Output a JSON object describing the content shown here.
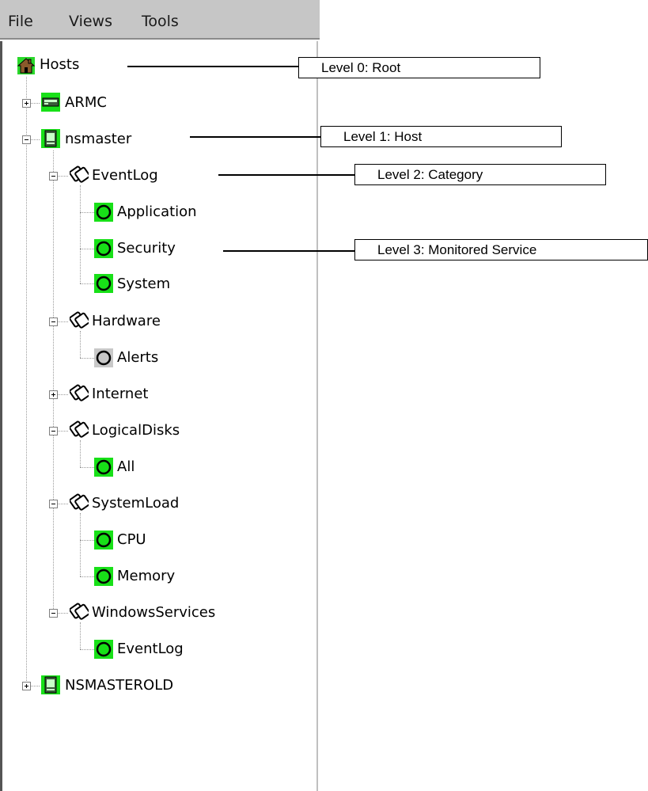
{
  "menu": {
    "file": "File",
    "views": "Views",
    "tools": "Tools"
  },
  "tree": {
    "root": "Hosts",
    "host_armc": "ARMC",
    "host_nsmaster": "nsmaster",
    "cat_eventlog": "EventLog",
    "svc_application": "Application",
    "svc_security": "Security",
    "svc_system": "System",
    "cat_hardware": "Hardware",
    "svc_alerts": "Alerts",
    "cat_internet": "Internet",
    "cat_logicaldisks": "LogicalDisks",
    "svc_all": "All",
    "cat_systemload": "SystemLoad",
    "svc_cpu": "CPU",
    "svc_memory": "Memory",
    "cat_windowsservices": "WindowsServices",
    "svc_eventlog": "EventLog",
    "host_nsmasterold": "NSMASTEROLD"
  },
  "callouts": {
    "level0": "Level 0: Root",
    "level1": "Level 1: Host",
    "level2": "Level 2: Category",
    "level3": "Level 3: Monitored Service"
  },
  "colors": {
    "status_ok": "#18e018",
    "status_unknown": "#c8c8c8",
    "menubar": "#c6c6c6"
  }
}
